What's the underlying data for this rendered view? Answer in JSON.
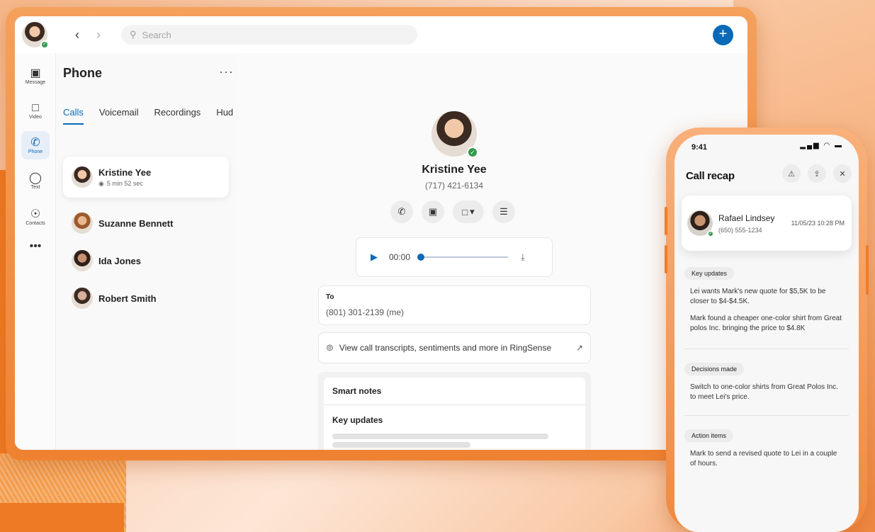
{
  "topbar": {
    "search_placeholder": "Search",
    "back_icon": "chevron-left-icon",
    "forward_icon": "chevron-right-icon",
    "new_icon": "plus-icon"
  },
  "rail": {
    "items": [
      {
        "label": "Message",
        "icon": "message-icon"
      },
      {
        "label": "Video",
        "icon": "video-icon"
      },
      {
        "label": "Phone",
        "icon": "phone-icon",
        "active": true
      },
      {
        "label": "Text",
        "icon": "chat-bubble-icon"
      },
      {
        "label": "Contacts",
        "icon": "contact-icon"
      },
      {
        "label": "",
        "icon": "more-icon"
      }
    ]
  },
  "list": {
    "title": "Phone",
    "tabs": [
      "Calls",
      "Voicemail",
      "Recordings",
      "Hud"
    ],
    "contacts": [
      {
        "name": "Kristine Yee",
        "meta": "5 min 52 sec"
      },
      {
        "name": "Suzanne Bennett"
      },
      {
        "name": "Ida Jones"
      },
      {
        "name": "Robert Smith"
      }
    ]
  },
  "detail": {
    "name": "Kristine Yee",
    "phone": "(717) 421-6134",
    "player": {
      "time": "00:00",
      "progress": 0
    },
    "to_label": "To",
    "to_value": "(801) 301-2139 (me)",
    "ringsense_text": "View call transcripts, sentiments and more in RingSense",
    "notes_title": "Smart notes",
    "notes_sub": "Key updates"
  },
  "phone": {
    "time": "9:41",
    "title": "Call recap",
    "caller": {
      "name": "Rafael Lindsey",
      "phone": "(650) 555-1234",
      "date": "11/05/23 10:28 PM"
    },
    "sections": [
      {
        "label": "Key updates",
        "items": [
          "Lei wants Mark's new quote for $5,5K to be closer to $4-$4.5K.",
          "Mark found a cheaper one-color shirt from Great polos Inc. bringing the price to $4.8K"
        ]
      },
      {
        "label": "Decisions made",
        "items": [
          "Switch to one-color shirts from Great Polos Inc. to meet Lei's price."
        ]
      },
      {
        "label": "Action items",
        "items": [
          "Mark to send a revised quote to Lei in a couple of hours."
        ]
      }
    ]
  },
  "colors": {
    "accent": "#0a6ab7",
    "status_green": "#2f9b4c",
    "brand_orange": "#f08a3f"
  }
}
